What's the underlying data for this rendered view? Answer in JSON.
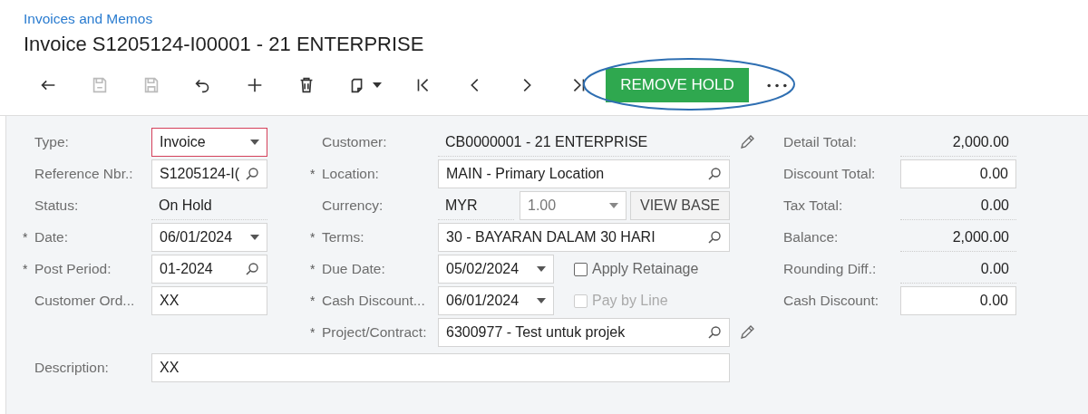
{
  "breadcrumb": "Invoices and Memos",
  "title": "Invoice S1205124-I00001 - 21 ENTERPRISE",
  "toolbar": {
    "buttons": [
      {
        "kind": "back",
        "disabled": false
      },
      {
        "kind": "save-close",
        "disabled": true
      },
      {
        "kind": "save",
        "disabled": true
      },
      {
        "kind": "undo",
        "disabled": false
      },
      {
        "kind": "add",
        "disabled": false
      },
      {
        "kind": "delete",
        "disabled": false
      },
      {
        "kind": "copy",
        "disabled": false
      },
      {
        "kind": "first",
        "disabled": false
      },
      {
        "kind": "prev",
        "disabled": false
      },
      {
        "kind": "next",
        "disabled": false
      },
      {
        "kind": "last",
        "disabled": false
      }
    ],
    "primary": "REMOVE HOLD"
  },
  "columns": [
    [
      {
        "label": "Type:",
        "kind": "select",
        "value": "Invoice",
        "highlighted": true
      },
      {
        "label": "Reference Nbr.:",
        "kind": "lookup",
        "value": "S1205124-I("
      },
      {
        "label": "Status:",
        "kind": "readonly",
        "value": "On Hold"
      },
      {
        "label": "Date:",
        "mark": "*",
        "kind": "select",
        "value": "06/01/2024"
      },
      {
        "label": "Post Period:",
        "mark": "*",
        "kind": "lookup",
        "value": "01-2024"
      },
      {
        "label": "Customer Ord...",
        "kind": "text",
        "value": "XX"
      }
    ],
    [
      {
        "label": "Customer:",
        "kind": "readonly",
        "value": "CB0000001 - 21 ENTERPRISE",
        "editable": true
      },
      {
        "label": "Location:",
        "mark": "*",
        "kind": "lookup",
        "value": "MAIN - Primary Location"
      },
      {
        "label": "Currency:",
        "kind": "currency",
        "value": "MYR",
        "rate": "1.00",
        "button": "VIEW BASE"
      },
      {
        "label": "Terms:",
        "mark": "*",
        "kind": "lookup",
        "value": "30 - BAYARAN DALAM 30 HARI"
      },
      {
        "label": "Due Date:",
        "mark": "*",
        "kind": "date",
        "value": "05/02/2024",
        "checkbox": {
          "label": "Apply Retainage",
          "checked": false,
          "disabled": false
        }
      },
      {
        "label": "Cash Discount...",
        "mark": "*",
        "kind": "date",
        "value": "06/01/2024",
        "checkbox": {
          "label": "Pay by Line",
          "checked": false,
          "disabled": true
        }
      },
      {
        "label": "Project/Contract:",
        "mark": "*",
        "kind": "lookup",
        "value": "6300977 - Test untuk projek",
        "editable": true
      }
    ],
    [
      {
        "label": "Detail Total:",
        "kind": "readonly-number",
        "value": "2,000.00"
      },
      {
        "label": "Discount Total:",
        "kind": "number",
        "value": "0.00"
      },
      {
        "label": "Tax Total:",
        "kind": "readonly-number",
        "value": "0.00"
      },
      {
        "label": "Balance:",
        "kind": "readonly-number",
        "value": "2,000.00"
      },
      {
        "label": "Rounding Diff.:",
        "kind": "readonly-number",
        "value": "0.00"
      },
      {
        "label": "Cash Discount:",
        "kind": "number",
        "value": "0.00"
      }
    ]
  ],
  "description": {
    "label": "Description:",
    "value": "XX"
  }
}
